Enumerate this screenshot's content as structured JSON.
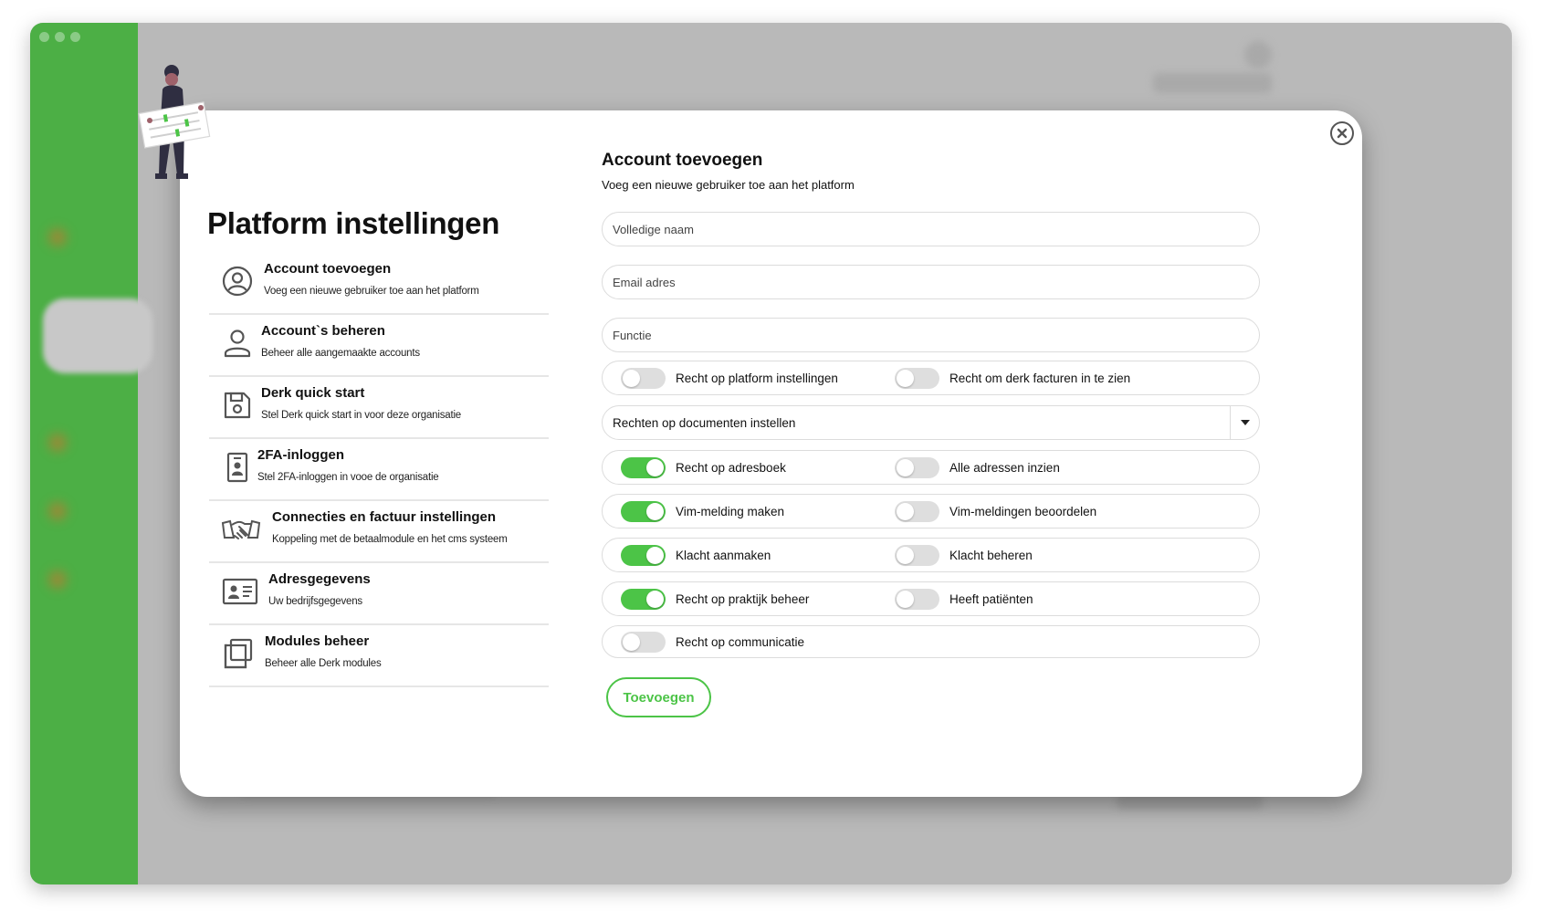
{
  "modal": {
    "page_title": "Platform instellingen",
    "menu": [
      {
        "label": "Account toevoegen",
        "sub": "Voeg een nieuwe gebruiker toe aan het platform",
        "icon": "user-circle-icon"
      },
      {
        "label": "Account`s beheren",
        "sub": "Beheer alle aangemaakte accounts",
        "icon": "user-icon"
      },
      {
        "label": "Derk quick start",
        "sub": "Stel Derk quick start in voor deze organisatie",
        "icon": "save-icon"
      },
      {
        "label": "2FA-inloggen",
        "sub": "Stel 2FA-inloggen in vooe de organisatie",
        "icon": "id-badge-icon"
      },
      {
        "label": "Connecties en factuur instellingen",
        "sub": "Koppeling met de betaalmodule en het cms systeem",
        "icon": "handshake-icon"
      },
      {
        "label": "Adresgegevens",
        "sub": "Uw bedrijfsgegevens",
        "icon": "id-card-icon"
      },
      {
        "label": "Modules beheer",
        "sub": "Beheer alle Derk modules",
        "icon": "copy-icon"
      }
    ],
    "form": {
      "title": "Account toevoegen",
      "subtitle": "Voeg een nieuwe gebruiker toe aan het platform",
      "name_placeholder": "Volledige naam",
      "email_placeholder": "Email adres",
      "function_placeholder": "Functie",
      "documents_select": "Rechten op documenten instellen",
      "toggles": [
        {
          "label": "Recht op platform instellingen",
          "on": false
        },
        {
          "label": "Recht om derk facturen in te zien",
          "on": false
        },
        {
          "label": "Recht op adresboek",
          "on": true
        },
        {
          "label": "Alle adressen inzien",
          "on": false
        },
        {
          "label": "Vim-melding maken",
          "on": true
        },
        {
          "label": "Vim-meldingen beoordelen",
          "on": false
        },
        {
          "label": "Klacht aanmaken",
          "on": true
        },
        {
          "label": "Klacht beheren",
          "on": false
        },
        {
          "label": "Recht op praktijk beheer",
          "on": true
        },
        {
          "label": "Heeft patiënten",
          "on": false
        },
        {
          "label": "Recht op communicatie",
          "on": false
        }
      ],
      "submit_label": "Toevoegen"
    }
  },
  "colors": {
    "accent": "#4cc447",
    "sidebar": "#4caf45"
  }
}
